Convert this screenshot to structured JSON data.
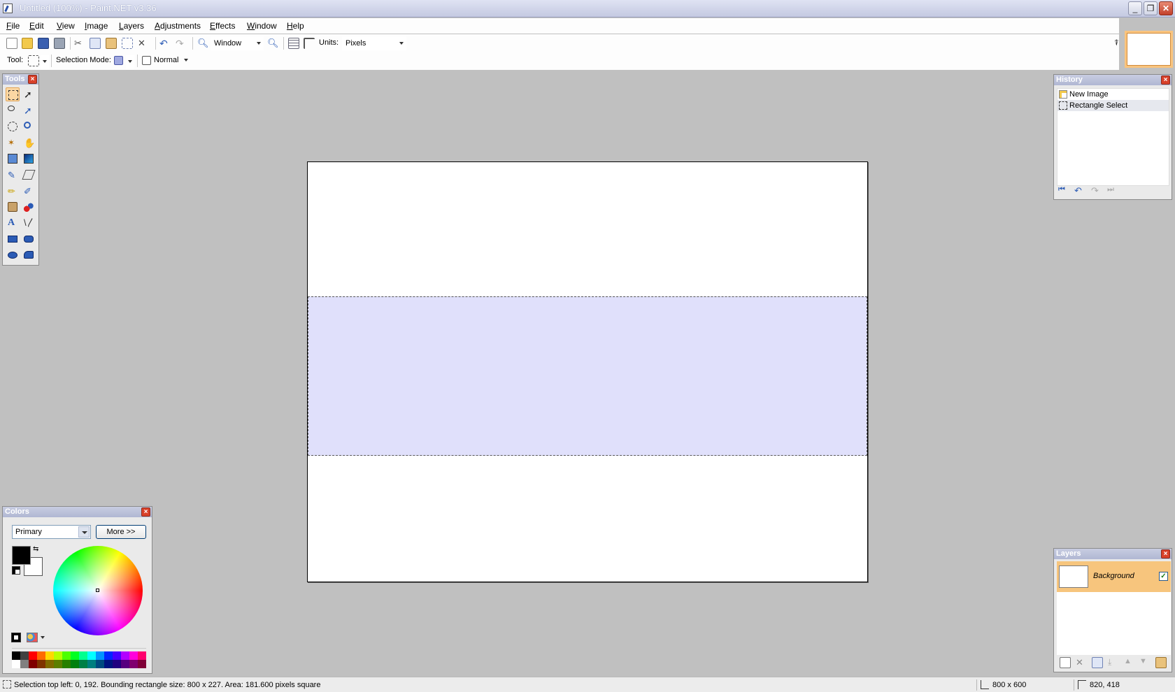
{
  "window": {
    "title": "Untitled (100%) - Paint.NET v3.36",
    "controls": [
      "_",
      "❐",
      "✕"
    ]
  },
  "menu": [
    "File",
    "Edit",
    "View",
    "Image",
    "Layers",
    "Adjustments",
    "Effects",
    "Window",
    "Help"
  ],
  "toolbar": {
    "zoom_value": "Window",
    "units_label": "Units:",
    "units_value": "Pixels",
    "tool_label": "Tool:",
    "selection_mode_label": "Selection Mode:",
    "blend_value": "Normal"
  },
  "panels": {
    "tools": {
      "title": "Tools"
    },
    "history": {
      "title": "History",
      "items": [
        "New Image",
        "Rectangle Select"
      ]
    },
    "layers": {
      "title": "Layers",
      "items": [
        {
          "name": "Background",
          "visible": true
        }
      ]
    },
    "colors": {
      "title": "Colors",
      "mode": "Primary",
      "more_button": "More >>",
      "primary": "#000000",
      "secondary": "#ffffff",
      "palette": [
        "#000000",
        "#404040",
        "#ff0000",
        "#ff6a00",
        "#ffd800",
        "#b6ff00",
        "#4cff00",
        "#00ff21",
        "#00ff90",
        "#00ffff",
        "#0094ff",
        "#0026ff",
        "#4800ff",
        "#b200ff",
        "#ff00dc",
        "#ff006e",
        "#ffffff",
        "#808080",
        "#7f0000",
        "#7f3300",
        "#7f6a00",
        "#5b7f00",
        "#267f00",
        "#007f0e",
        "#007f46",
        "#007f7f",
        "#004a7f",
        "#00137f",
        "#21007f",
        "#57007f",
        "#7f006e",
        "#7f0037"
      ]
    }
  },
  "canvas": {
    "width": 800,
    "height": 600,
    "selection_color": "#e0e0fb"
  },
  "status": {
    "message": "Selection top left: 0, 192. Bounding rectangle size: 800 x 227. Area: 181.600 pixels square",
    "image_size": "800 x 600",
    "cursor": "820, 418"
  }
}
